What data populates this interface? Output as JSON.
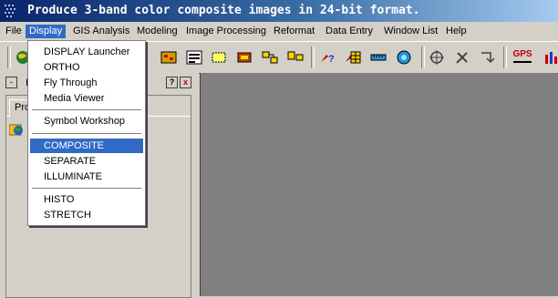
{
  "window": {
    "title": "Produce 3-band color composite images in 24-bit format."
  },
  "menubar": {
    "items": [
      {
        "label": "File"
      },
      {
        "label": "Display",
        "active": true
      },
      {
        "label": "GIS Analysis"
      },
      {
        "label": "Modeling"
      },
      {
        "label": "Image Processing"
      },
      {
        "label": "Reformat"
      },
      {
        "label": "Data Entry"
      },
      {
        "label": "Window List"
      },
      {
        "label": "Help"
      }
    ]
  },
  "display_menu": {
    "items": [
      {
        "label": "DISPLAY Launcher"
      },
      {
        "label": "ORTHO"
      },
      {
        "label": "Fly Through"
      },
      {
        "label": "Media Viewer"
      },
      {
        "label": "Symbol Workshop"
      },
      {
        "label": "COMPOSITE",
        "highlighted": true
      },
      {
        "label": "SEPARATE"
      },
      {
        "label": "ILLUMINATE"
      },
      {
        "label": "HISTO"
      },
      {
        "label": "STRETCH"
      }
    ]
  },
  "toolbar": {
    "gps_label": "GPS"
  },
  "left_panel": {
    "title_fragment": "I",
    "tab_label": "Pro",
    "help_label": "?",
    "close_label": "x",
    "minimize_label": "-"
  },
  "colors": {
    "highlight": "#316ac5",
    "titlebar": "#0a246a",
    "viewer_bg": "#808080",
    "face": "#d4d0c8"
  }
}
